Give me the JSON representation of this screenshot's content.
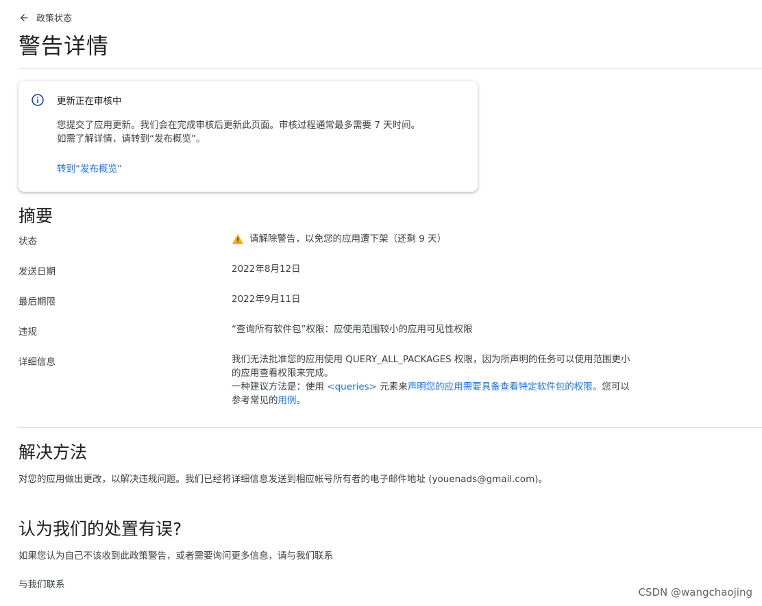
{
  "back": {
    "label": "政策状态",
    "icon": "arrow-left-icon"
  },
  "page_title": "警告详情",
  "notice": {
    "icon": "info-icon",
    "title": "更新正在审核中",
    "body_line1": "您提交了应用更新。我们会在完成审核后更新此页面。审核过程通常最多需要 7 天时间。",
    "body_line2": "如需了解详情，请转到“发布概览”。",
    "link": "转到“发布概览”"
  },
  "summary": {
    "title": "摘要",
    "status_label": "状态",
    "status_value": "请解除警告，以免您的应用遭下架（还剩 9 天）",
    "sent_label": "发送日期",
    "sent_value": "2022年8月12日",
    "deadline_label": "最后期限",
    "deadline_value": "2022年9月11日",
    "violation_label": "违规",
    "violation_value": "“查询所有软件包”权限：应使用范围较小的应用可见性权限",
    "detail_label": "详细信息",
    "detail_p1": "我们无法批准您的应用使用 QUERY_ALL_PACKAGES 权限，因为所声明的任务可以使用范围更小的应用查看权限来完成。",
    "detail_p2_prefix": "一种建议方法是：使用 ",
    "detail_p2_code_link": "<queries>",
    "detail_p2_mid": " 元素来",
    "detail_p2_link": "声明您的应用需要具备查看特定软件包的权限",
    "detail_p2_suffix": "。您可以参考常见的",
    "detail_p2_usecase_link": "用例",
    "detail_p2_end": "。"
  },
  "resolve": {
    "title": "解决方法",
    "body": "对您的应用做出更改，以解决违规问题。我们已经将详细信息发送到相应帐号所有者的电子邮件地址 (youenads@gmail.com)。"
  },
  "appeal": {
    "title": "认为我们的处置有误?",
    "body": "如果您认为自己不该收到此政策警告，或者需要询问更多信息，请与我们联系",
    "contact": "与我们联系"
  },
  "watermark": "CSDN @wangchaojing",
  "colors": {
    "link": "#1a73e8",
    "warning": "#f9ab00",
    "info": "#174ea6"
  }
}
